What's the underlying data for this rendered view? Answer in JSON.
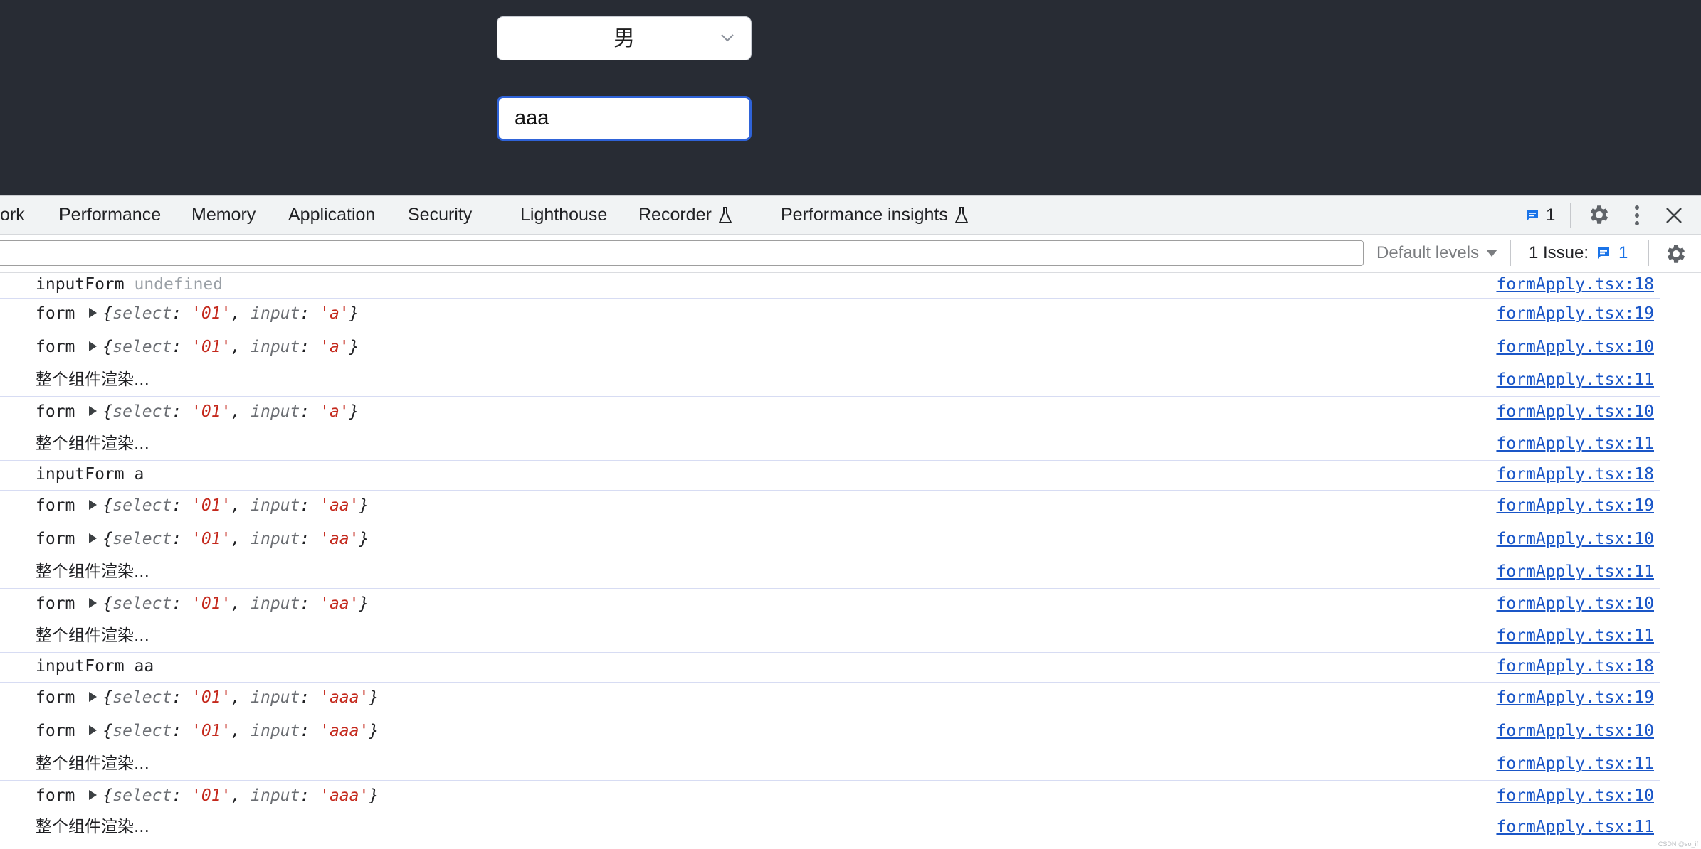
{
  "app": {
    "select_value": "男",
    "input_value": "aaa"
  },
  "devtools": {
    "tabs": [
      {
        "label": "ork",
        "flask": false
      },
      {
        "label": "Performance",
        "flask": false
      },
      {
        "label": "Memory",
        "flask": false
      },
      {
        "label": "Application",
        "flask": false
      },
      {
        "label": "Security",
        "flask": false
      },
      {
        "label": "Lighthouse",
        "flask": false
      },
      {
        "label": "Recorder",
        "flask": true
      },
      {
        "label": "Performance insights",
        "flask": true
      }
    ],
    "issues_badge": "1",
    "toolbar": {
      "levels_label": "Default levels",
      "issues_label": "1 Issue:",
      "issues_count": "1"
    }
  },
  "console": {
    "rows": [
      {
        "type": "text",
        "label": "inputForm",
        "value": "undefined",
        "value_style": "undef",
        "source": "formApply.tsx:18"
      },
      {
        "type": "object",
        "label": "form",
        "select": "'01'",
        "input": "'a'",
        "source": "formApply.tsx:19"
      },
      {
        "type": "object",
        "label": "form",
        "select": "'01'",
        "input": "'a'",
        "source": "formApply.tsx:10"
      },
      {
        "type": "message",
        "text": "整个组件渲染...",
        "source": "formApply.tsx:11"
      },
      {
        "type": "object",
        "label": "form",
        "select": "'01'",
        "input": "'a'",
        "source": "formApply.tsx:10"
      },
      {
        "type": "message",
        "text": "整个组件渲染...",
        "source": "formApply.tsx:11"
      },
      {
        "type": "text",
        "label": "inputForm",
        "value": "a",
        "value_style": "plain",
        "source": "formApply.tsx:18"
      },
      {
        "type": "object",
        "label": "form",
        "select": "'01'",
        "input": "'aa'",
        "source": "formApply.tsx:19"
      },
      {
        "type": "object",
        "label": "form",
        "select": "'01'",
        "input": "'aa'",
        "source": "formApply.tsx:10"
      },
      {
        "type": "message",
        "text": "整个组件渲染...",
        "source": "formApply.tsx:11"
      },
      {
        "type": "object",
        "label": "form",
        "select": "'01'",
        "input": "'aa'",
        "source": "formApply.tsx:10"
      },
      {
        "type": "message",
        "text": "整个组件渲染...",
        "source": "formApply.tsx:11"
      },
      {
        "type": "text",
        "label": "inputForm",
        "value": "aa",
        "value_style": "plain",
        "source": "formApply.tsx:18"
      },
      {
        "type": "object",
        "label": "form",
        "select": "'01'",
        "input": "'aaa'",
        "source": "formApply.tsx:19"
      },
      {
        "type": "object",
        "label": "form",
        "select": "'01'",
        "input": "'aaa'",
        "source": "formApply.tsx:10"
      },
      {
        "type": "message",
        "text": "整个组件渲染...",
        "source": "formApply.tsx:11"
      },
      {
        "type": "object",
        "label": "form",
        "select": "'01'",
        "input": "'aaa'",
        "source": "formApply.tsx:10"
      },
      {
        "type": "message",
        "text": "整个组件渲染...",
        "source": "formApply.tsx:11"
      }
    ]
  },
  "watermark": "CSDN @so_if"
}
